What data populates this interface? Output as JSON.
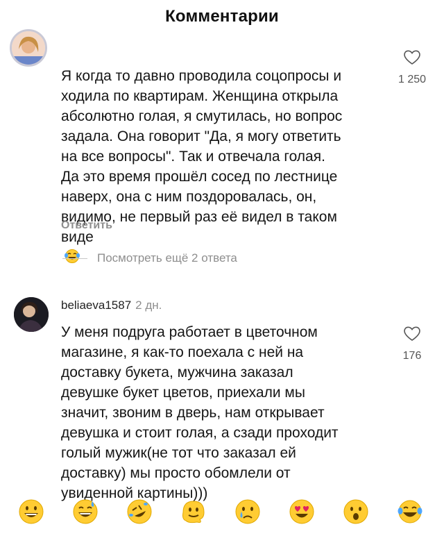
{
  "header": {
    "title": "Комментарии"
  },
  "comments": [
    {
      "username": "",
      "age": "",
      "text": "Я когда то давно проводила соцопросы и\nходила по квартирам. Женщина открыла\nабсолютно голая, я смутилась, но вопрос\nзадала. Она говорит \"Да, я могу ответить\nна все вопросы\". Так и отвечала голая.\nДа это время прошёл сосед по лестнице\nнаверх, она с ним поздоровалась, он,\nвидимо, не первый раз её видел в таком\nвиде",
      "likes": "1 250",
      "reply_label": "Ответить",
      "more_replies": "Посмотреть ещё 2 ответа"
    },
    {
      "username": "beliaeva1587",
      "age": "2 дн.",
      "text": "У меня подруга работает в цветочном\nмагазине, я как-то поехала с ней на\nдоставку букета, мужчина заказал\nдевушке букет цветов, приехали мы\nзначит, звоним в дверь, нам открывает\nдевушка и стоит голая, а сзади проходит\nголый мужик(не тот что заказал ей\nдоставку) мы просто обомлели от\nувиденной картины)))",
      "likes": "176"
    }
  ],
  "emoji_bar": [
    "grinning-face",
    "grinning-sweat-face",
    "rolling-laughing-face",
    "melting-face",
    "crying-face",
    "heart-eyes-face",
    "surprised-face",
    "tears-of-joy-face"
  ],
  "colors": {
    "emoji_yellow": "#ffcc33",
    "secondary_text": "#8e8e8e",
    "heart_red": "#e0245e"
  }
}
